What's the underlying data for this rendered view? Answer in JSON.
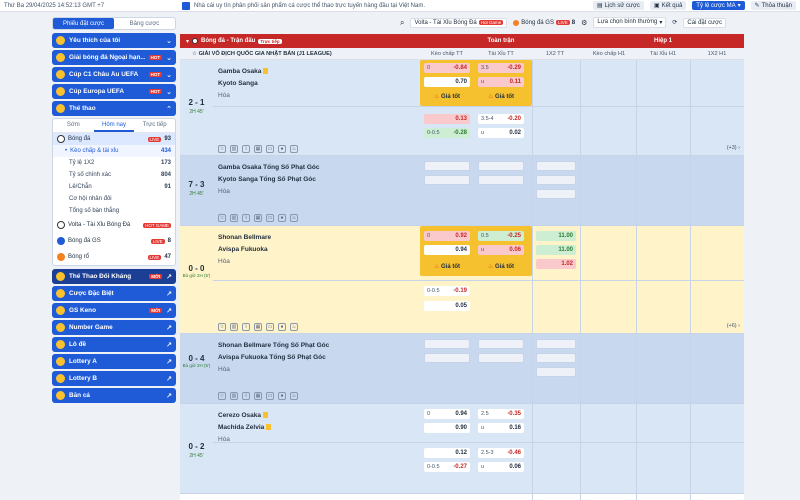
{
  "topbar": {
    "date": "Thứ Ba 29/04/2025 14:52:13 GMT +7",
    "notice": "Nhà cái uy tín phân phối sản phẩm cá cược thể thao trực tuyến hàng đầu tại Việt Nam.",
    "history": "Lịch sử cược",
    "results": "Kết quả",
    "odds_type": "Tỷ lệ cược MA",
    "agreement": "Thỏa thuận"
  },
  "subbar": {
    "volta_label": "Volta - Tài Xỉu Bóng Đá",
    "volta_badge": "Hot Game",
    "gs_label": "Bóng đá GS",
    "gs_live": "LIVE",
    "gs_count": "8",
    "sort_label": "Lựa chọn bình thường",
    "settings": "Cài đặt cược"
  },
  "sidebar": {
    "tab_slip": "Phiếu đặt cược",
    "tab_board": "Bảng cược",
    "items": [
      {
        "label": "Yêu thích của tôi"
      },
      {
        "label": "Giải bóng đá Ngoại hạn...",
        "badge": "HOT"
      },
      {
        "label": "Cúp C1 Châu Âu UEFA",
        "badge": "HOT"
      },
      {
        "label": "Cúp Europa UEFA",
        "badge": "HOT"
      }
    ],
    "sports_title": "Thể thao",
    "subtabs": [
      "Sớm",
      "Hôm nay",
      "Trực tiếp"
    ],
    "soccer": {
      "label": "Bóng đá",
      "live": "LIVE",
      "count": "93"
    },
    "soccer_rows": [
      {
        "label": "Kèo chấp & tài xỉu",
        "count": "434"
      },
      {
        "label": "Tỷ lệ 1X2",
        "count": "173"
      },
      {
        "label": "Tỷ số chính xác",
        "count": "804"
      },
      {
        "label": "Lẻ/Chẵn",
        "count": "91"
      },
      {
        "label": "Cơ hội nhân đôi",
        "count": ""
      },
      {
        "label": "Tổng số bàn thắng",
        "count": ""
      }
    ],
    "others": [
      {
        "label": "Volta - Tài Xỉu Bóng Đá",
        "badge": "HOT GAME"
      },
      {
        "label": "Bóng đá GS",
        "badge": "LIVE",
        "count": "8"
      },
      {
        "label": "Bóng rổ",
        "badge": "LIVE",
        "count": "47"
      }
    ],
    "bottom": [
      {
        "label": "Thể Thao Đối Kháng",
        "badge": "MỚI"
      },
      {
        "label": "Cược Đặc Biệt"
      },
      {
        "label": "GS Keno",
        "badge": "MỚI"
      },
      {
        "label": "Number Game"
      },
      {
        "label": "Lô đề"
      },
      {
        "label": "Lottery A"
      },
      {
        "label": "Lottery B"
      },
      {
        "label": "Bắn cá"
      }
    ]
  },
  "main": {
    "sport_title": "Bóng đá - Trận đấu",
    "live_tag": "Trực tiếp",
    "fulltime": "Toàn trận",
    "half1": "Hiệp 1",
    "league": "GIẢI VÔ ĐỊCH QUỐC GIA NHẬT BẢN (J1 LEAGUE)",
    "cols": [
      "Kèo chấp TT",
      "Tài Xỉu TT",
      "1X2 TT",
      "Kèo chấp H1",
      "Tài Xỉu H1",
      "1X2 H1"
    ],
    "good": "Giá tốt",
    "draw": "Hòa",
    "matches": [
      {
        "score": "2 - 1",
        "time": "2H 45'",
        "home": "Gamba Osaka",
        "away": "Kyoto Sanga",
        "r1": {
          "hdp_h": "0",
          "hdp_hv": "-0.84",
          "hdp_av": "0.70",
          "ou_h": "3.5",
          "ou_hv": "-0.29",
          "ou_u": "u",
          "ou_av": "0.11"
        },
        "r2": {
          "hdp_hv": "0.13",
          "hdp_h": "0-0.5",
          "hdp_av": "-0.28",
          "ou_h": "3.5-4",
          "ou_hv": "-0.20",
          "ou_u": "u",
          "ou_av": "0.02"
        },
        "more": "(+3)"
      },
      {
        "score": "7 - 3",
        "time": "2H 45'",
        "home": "Gamba Osaka Tổng Số Phạt Góc",
        "away": "Kyoto Sanga Tổng Số Phạt Góc"
      },
      {
        "score": "0 - 0",
        "time": "Bù giờ 2H (5')",
        "home": "Shonan Bellmare",
        "away": "Avispa Fukuoka",
        "r1": {
          "hdp_h": "0",
          "hdp_hv": "0.92",
          "hdp_av": "0.94",
          "ou_h": "0.5",
          "ou_hv": "-0.25",
          "ou_u": "u",
          "ou_av": "0.06",
          "x1": "11.00",
          "x2": "11.00",
          "xd": "1.02"
        },
        "r2": {
          "hdp_h": "0-0.5",
          "hdp_hv": "-0.19",
          "hdp_av": "0.05"
        },
        "more": "(+6)"
      },
      {
        "score": "0 - 4",
        "time": "Bù giờ 2H (5')",
        "home": "Shonan Bellmare Tổng Số Phạt Góc",
        "away": "Avispa Fukuoka Tổng Số Phạt Góc"
      },
      {
        "score": "0 - 2",
        "time": "2H 45'",
        "home": "Cerezo Osaka",
        "away": "Machida Zelvia",
        "r1": {
          "hdp_h": "0",
          "hdp_hv": "0.94",
          "hdp_av": "0.90",
          "ou_h": "2.5",
          "ou_hv": "-0.35",
          "ou_u": "u",
          "ou_av": "0.16"
        },
        "r2": {
          "hdp_hv": "0.12",
          "hdp_h": "0-0.5",
          "hdp_av": "-0.27",
          "ou_h": "2.5-3",
          "ou_hv": "-0.46",
          "ou_u": "u",
          "ou_av": "0.06"
        }
      }
    ]
  }
}
